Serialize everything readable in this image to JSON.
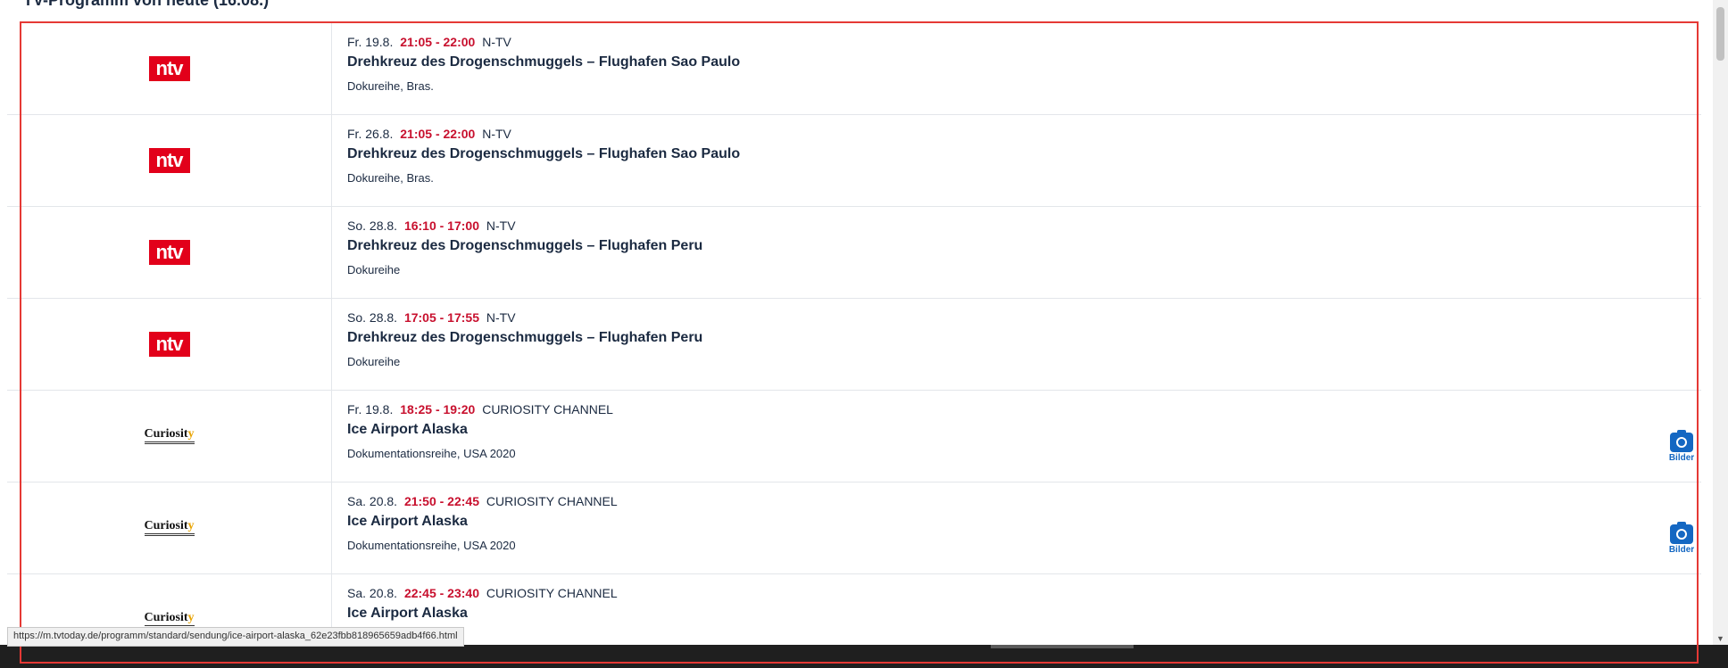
{
  "page": {
    "title": "TV-Programm von heute (16.08.)"
  },
  "listings": [
    {
      "channel_logo": "ntv",
      "date": "Fr. 19.8.",
      "time": "21:05 - 22:00",
      "channel": "N-TV",
      "title": "Drehkreuz des Drogenschmuggels – Flughafen Sao Paulo",
      "genre": "Dokureihe, Bras.",
      "has_images": false
    },
    {
      "channel_logo": "ntv",
      "date": "Fr. 26.8.",
      "time": "21:05 - 22:00",
      "channel": "N-TV",
      "title": "Drehkreuz des Drogenschmuggels – Flughafen Sao Paulo",
      "genre": "Dokureihe, Bras.",
      "has_images": false
    },
    {
      "channel_logo": "ntv",
      "date": "So. 28.8.",
      "time": "16:10 - 17:00",
      "channel": "N-TV",
      "title": "Drehkreuz des Drogenschmuggels – Flughafen Peru",
      "genre": "Dokureihe",
      "has_images": false
    },
    {
      "channel_logo": "ntv",
      "date": "So. 28.8.",
      "time": "17:05 - 17:55",
      "channel": "N-TV",
      "title": "Drehkreuz des Drogenschmuggels – Flughafen Peru",
      "genre": "Dokureihe",
      "has_images": false
    },
    {
      "channel_logo": "curiosity",
      "date": "Fr. 19.8.",
      "time": "18:25 - 19:20",
      "channel": "CURIOSITY CHANNEL",
      "title": "Ice Airport Alaska",
      "genre": "Dokumentationsreihe, USA 2020",
      "has_images": true
    },
    {
      "channel_logo": "curiosity",
      "date": "Sa. 20.8.",
      "time": "21:50 - 22:45",
      "channel": "CURIOSITY CHANNEL",
      "title": "Ice Airport Alaska",
      "genre": "Dokumentationsreihe, USA 2020",
      "has_images": true
    },
    {
      "channel_logo": "curiosity",
      "date": "Sa. 20.8.",
      "time": "22:45 - 23:40",
      "channel": "CURIOSITY CHANNEL",
      "title": "Ice Airport Alaska",
      "genre": "",
      "has_images": false
    }
  ],
  "logos": {
    "ntv_text": "ntv",
    "curiosity_text": "Curiosit",
    "curiosity_y": "y"
  },
  "bilder_label": "Bilder",
  "status_bar": {
    "url": "https://m.tvtoday.de/programm/standard/sendung/ice-airport-alaska_62e23fbb818965659adb4f66.html"
  },
  "colors": {
    "accent_time": "#c8102e",
    "ntv_red": "#e2001a",
    "highlight_frame": "#e53935",
    "camera_blue": "#1467c2"
  },
  "icons": {
    "images": "camera-icon",
    "scroll_down": "chevron-down-icon"
  }
}
